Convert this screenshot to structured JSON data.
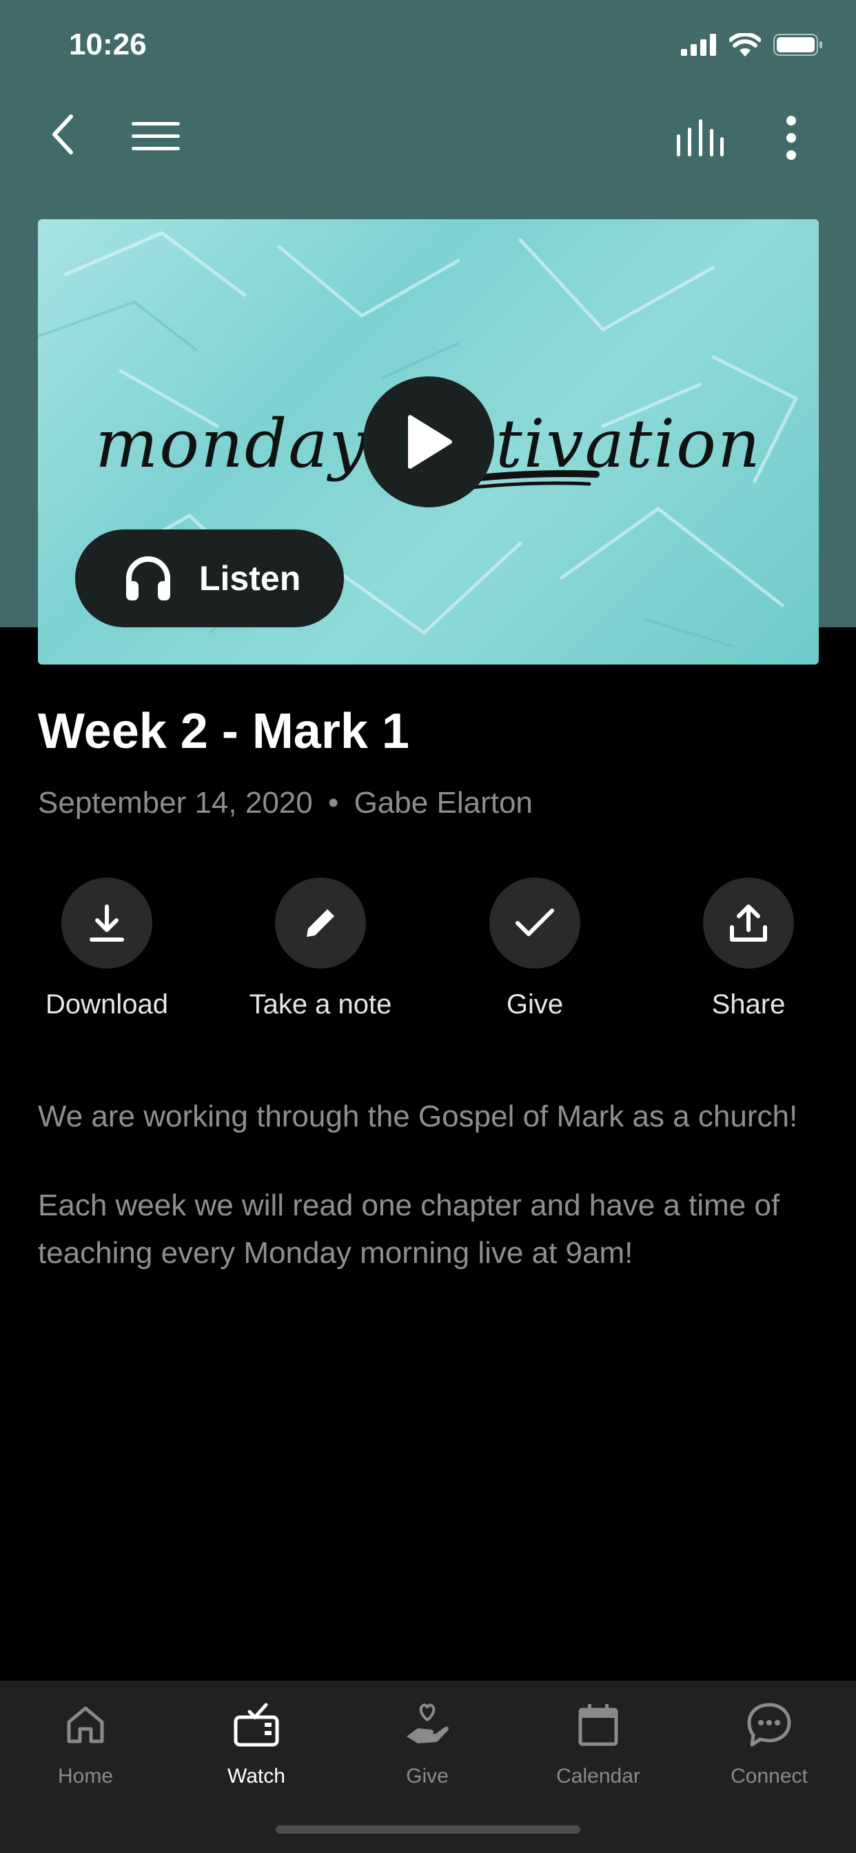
{
  "status_bar": {
    "time": "10:26"
  },
  "hero": {
    "title": "monday motivation",
    "listen_label": "Listen"
  },
  "sermon": {
    "title": "Week 2 - Mark 1",
    "date": "September 14, 2020",
    "speaker": "Gabe Elarton",
    "separator": "•"
  },
  "actions": [
    {
      "label": "Download",
      "icon": "download-icon"
    },
    {
      "label": "Take a note",
      "icon": "pencil-icon"
    },
    {
      "label": "Give",
      "icon": "check-icon"
    },
    {
      "label": "Share",
      "icon": "share-icon"
    }
  ],
  "description": [
    "We are working through the Gospel of Mark as a church!",
    "Each week we will read one chapter and have a time of teaching every Monday morning live at 9am!"
  ],
  "tabs": [
    {
      "label": "Home",
      "icon": "home-icon",
      "active": false
    },
    {
      "label": "Watch",
      "icon": "tv-icon",
      "active": true
    },
    {
      "label": "Give",
      "icon": "give-hand-icon",
      "active": false
    },
    {
      "label": "Calendar",
      "icon": "calendar-icon",
      "active": false
    },
    {
      "label": "Connect",
      "icon": "chat-bubble-icon",
      "active": false
    }
  ],
  "colors": {
    "header": "#426a6a",
    "background": "#000000",
    "tabbar": "#212121",
    "hero": "#7dd2d1"
  }
}
